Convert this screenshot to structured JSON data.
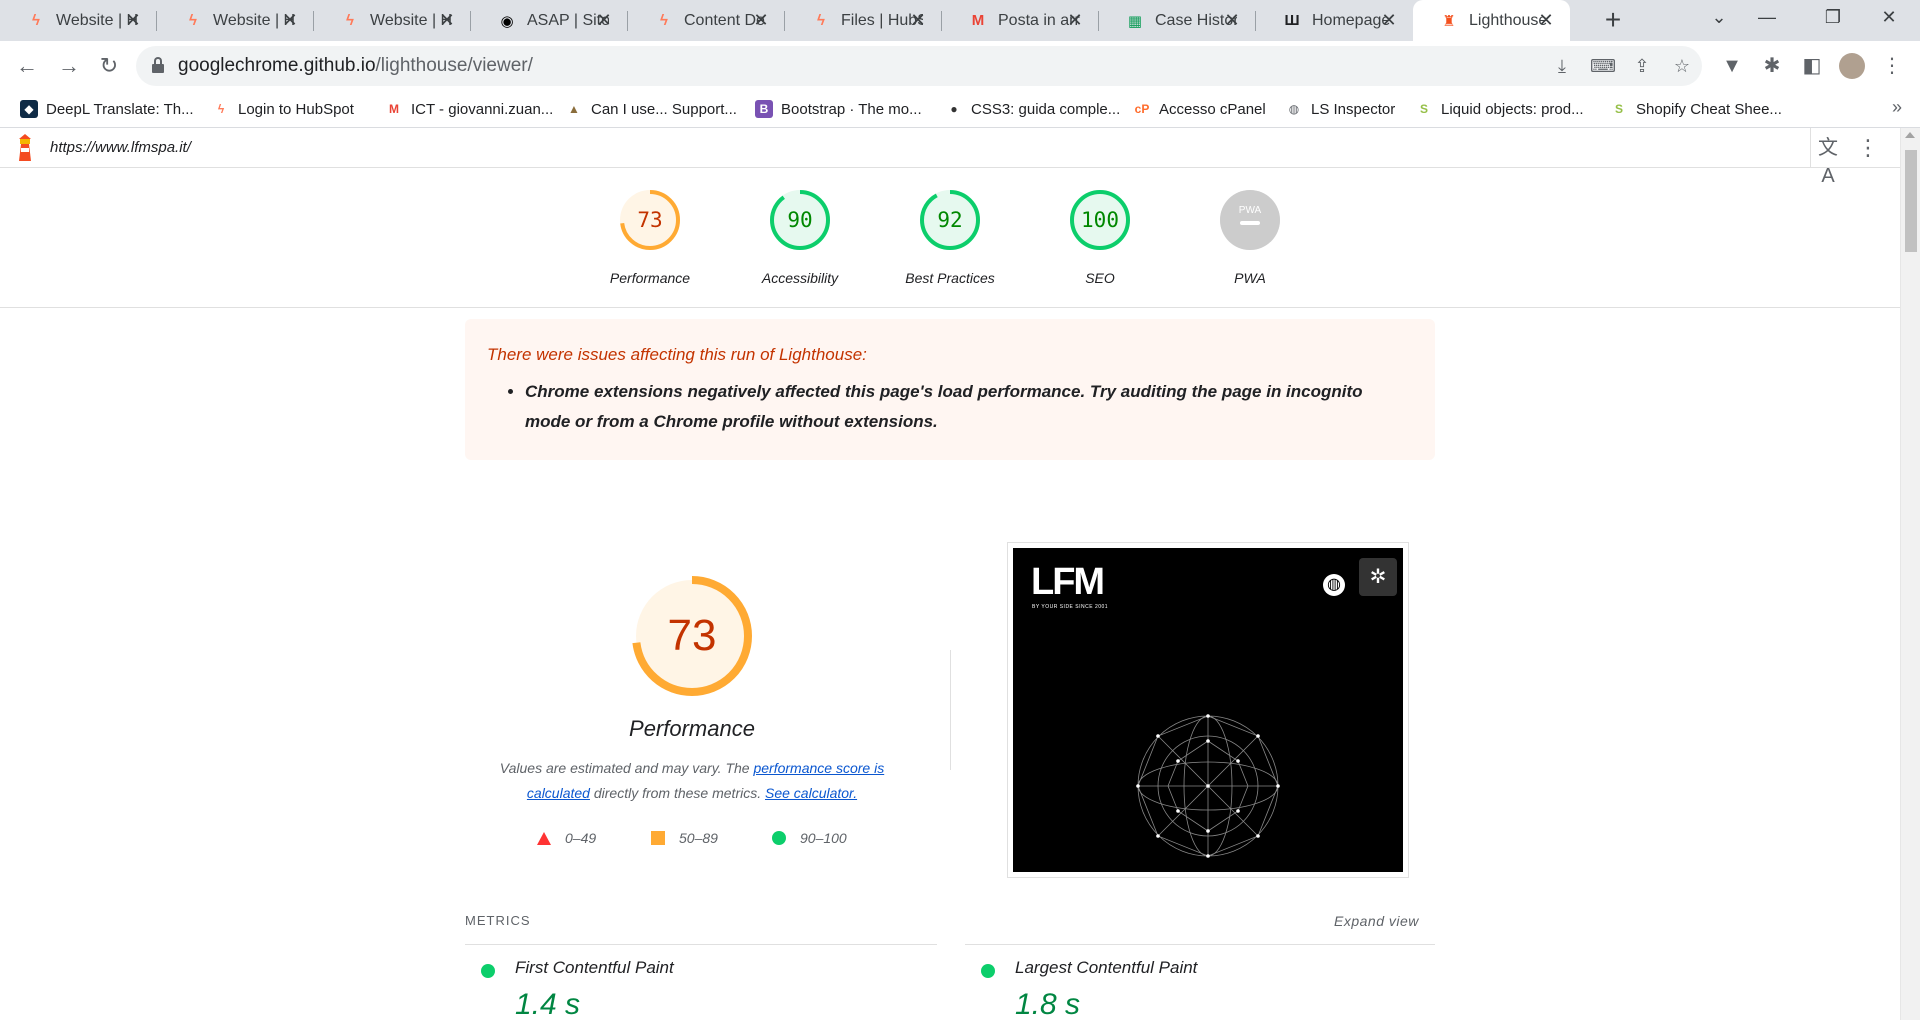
{
  "browser": {
    "tabs": [
      {
        "title": "Website | HubSpot",
        "icon": "hubspot-icon",
        "color": "#ff7a59"
      },
      {
        "title": "Website | HubSpot",
        "icon": "hubspot-icon",
        "color": "#ff7a59"
      },
      {
        "title": "Website | HubSpot",
        "icon": "hubspot-icon",
        "color": "#ff7a59"
      },
      {
        "title": "ASAP | Sito web",
        "icon": "asap-icon",
        "color": "#000000"
      },
      {
        "title": "Content Delivery",
        "icon": "hubspot-icon",
        "color": "#ff7a59"
      },
      {
        "title": "Files | HubSpot",
        "icon": "hubspot-icon",
        "color": "#ff7a59"
      },
      {
        "title": "Posta in arrivo",
        "icon": "gmail-icon",
        "color": "#ea4335"
      },
      {
        "title": "Case History",
        "icon": "sheets-icon",
        "color": "#0f9d58"
      },
      {
        "title": "Homepage",
        "icon": "lfm-icon",
        "color": "#202124"
      },
      {
        "title": "Lighthouse Report Viewer",
        "icon": "lighthouse-icon",
        "color": "#f4511e",
        "active": true
      }
    ],
    "url_host": "googlechrome.github.io",
    "url_path": "/lighthouse/viewer/",
    "bookmarks": [
      {
        "label": "DeepL Translate: Th...",
        "icon": "deepl-icon",
        "color": "#0f2b46"
      },
      {
        "label": "Login to HubSpot",
        "icon": "hubspot-icon",
        "color": "#ff7a59"
      },
      {
        "label": "ICT - giovanni.zuan...",
        "icon": "gmail-icon",
        "color": "#ea4335"
      },
      {
        "label": "Can I use... Support...",
        "icon": "caniuse-icon",
        "color": "#8a6d3b"
      },
      {
        "label": "Bootstrap · The mo...",
        "icon": "bootstrap-icon",
        "color": "#7952b3"
      },
      {
        "label": "CSS3: guida comple...",
        "icon": "css3-icon",
        "color": "#333333"
      },
      {
        "label": "Accesso cPanel",
        "icon": "cpanel-icon",
        "color": "#ff6c2c"
      },
      {
        "label": "LS Inspector",
        "icon": "globe-icon",
        "color": "#5f6368"
      },
      {
        "label": "Liquid objects: prod...",
        "icon": "shopify-icon",
        "color": "#95bf47"
      },
      {
        "label": "Shopify Cheat Shee...",
        "icon": "shopify-icon",
        "color": "#95bf47"
      }
    ]
  },
  "report": {
    "url": "https://www.lfmspa.it/",
    "categories": [
      {
        "label": "Performance",
        "score": "73",
        "color": "#ffaa33",
        "text_color": "#c33300",
        "bg": "#fff5e6",
        "fraction": 0.73
      },
      {
        "label": "Accessibility",
        "score": "90",
        "color": "#0cce6b",
        "text_color": "#008800",
        "bg": "#e6f9ef",
        "fraction": 0.9
      },
      {
        "label": "Best Practices",
        "score": "92",
        "color": "#0cce6b",
        "text_color": "#008800",
        "bg": "#e6f9ef",
        "fraction": 0.92
      },
      {
        "label": "SEO",
        "score": "100",
        "color": "#0cce6b",
        "text_color": "#008800",
        "bg": "#e6f9ef",
        "fraction": 1.0
      },
      {
        "label": "PWA",
        "score": "",
        "badge": "PWA",
        "color": "#cccccc",
        "text_color": "#ffffff",
        "bg": "#e8e8e8",
        "fraction": 0
      }
    ],
    "warning_title": "There were issues affecting this run of Lighthouse:",
    "warning_item": "Chrome extensions negatively affected this page's load performance. Try auditing the page in incognito mode or from a Chrome profile without extensions.",
    "performance": {
      "score": "73",
      "fraction": 0.73,
      "title": "Performance",
      "desc_pre": "Values are estimated and may vary. The ",
      "desc_link1": "performance score is calculated",
      "desc_mid": " directly from these metrics. ",
      "desc_link2": "See calculator."
    },
    "legend": [
      "0–49",
      "50–89",
      "90–100"
    ],
    "screenshot": {
      "logo": "LFM",
      "tagline": "BY YOUR SIDE SINCE 2001"
    },
    "metrics_label": "METRICS",
    "expand_label": "Expand view",
    "metrics": [
      {
        "name": "First Contentful Paint",
        "value": "1.4 s"
      },
      {
        "name": "Largest Contentful Paint",
        "value": "1.8 s"
      }
    ]
  }
}
